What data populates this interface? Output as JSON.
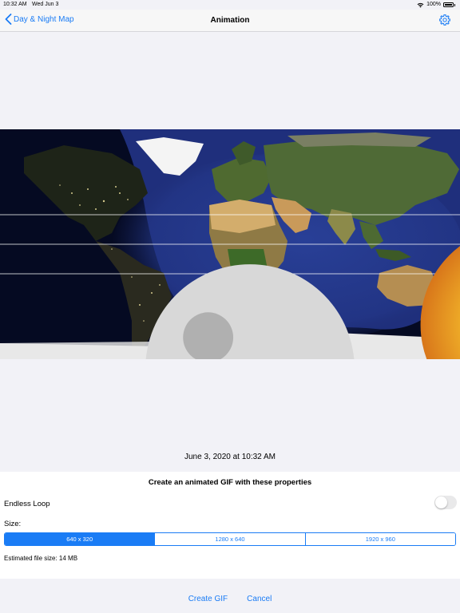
{
  "status_bar": {
    "time": "10:32 AM",
    "date": "Wed Jun 3",
    "battery": "100%",
    "wifi_icon": "wifi-icon",
    "battery_icon": "battery-icon"
  },
  "nav": {
    "back_label": "Day & Night Map",
    "title": "Animation",
    "settings_icon": "gear-icon",
    "back_icon": "chevron-left-icon"
  },
  "map": {
    "image": "world-day-night-map",
    "sun_icon": "sun-icon",
    "moon_icon": "moon-icon"
  },
  "date_text": "June 3, 2020 at 10:32 AM",
  "panel": {
    "title": "Create an animated GIF with these properties",
    "endless_loop_label": "Endless Loop",
    "endless_loop_on": false,
    "size_label": "Size:",
    "sizes": [
      "640 x 320",
      "1280 x 640",
      "1920 x 960"
    ],
    "selected_size_index": 0,
    "estimated_size": "Estimated file size: 14 MB"
  },
  "actions": {
    "create": "Create GIF",
    "cancel": "Cancel"
  },
  "colors": {
    "accent": "#1a7cf5",
    "background": "#f2f2f7",
    "night_ocean": "#1c2a6e"
  }
}
